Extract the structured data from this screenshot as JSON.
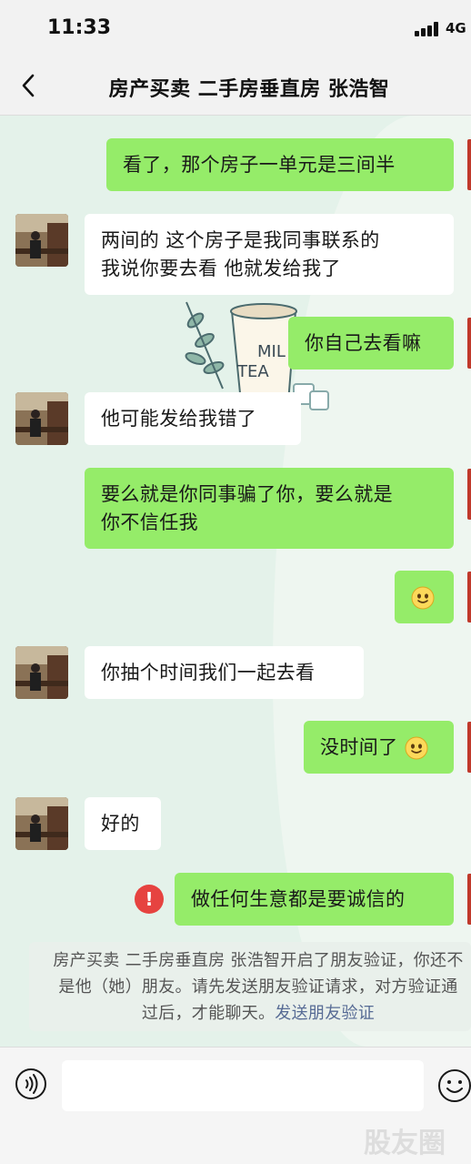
{
  "status_bar": {
    "time": "11:33",
    "network": "4G"
  },
  "nav": {
    "title": "房产买卖 二手房垂直房 张浩智",
    "back_icon": "chevron-left-icon"
  },
  "messages": [
    {
      "side": "right",
      "text": "看了，那个房子一单元是三间半"
    },
    {
      "side": "left",
      "lines": [
        "两间的  这个房子是我同事联系的",
        "我说你要去看 他就发给我了"
      ]
    },
    {
      "side": "right",
      "text": "你自己去看嘛"
    },
    {
      "side": "left",
      "text": "他可能发给我错了"
    },
    {
      "side": "right",
      "lines": [
        "要么就是你同事骗了你，要么就是",
        "你不信任我"
      ]
    },
    {
      "side": "right",
      "emoji": "smile-emoji"
    },
    {
      "side": "left",
      "text": "你抽个时间我们一起去看"
    },
    {
      "side": "right",
      "text": "没时间了",
      "emoji": "smile-emoji"
    },
    {
      "side": "left",
      "text": "好的"
    },
    {
      "side": "right",
      "text": "做任何生意都是要诚信的",
      "status": "failed"
    }
  ],
  "system_notice": {
    "line1": "房产买卖 二手房垂直房 张浩智开启了朋友验证，你还不",
    "line2": "是他（她）朋友。请先发送朋友验证请求，对方验证通",
    "line3_text": "过后，才能聊天。",
    "link": "发送朋友验证"
  },
  "wallpaper_text": {
    "line1": "MIL",
    "line2": "TEA"
  },
  "input_bar": {
    "voice_icon": "voice-icon",
    "emoji_icon": "emoji-icon"
  },
  "watermark": "股友圈"
}
